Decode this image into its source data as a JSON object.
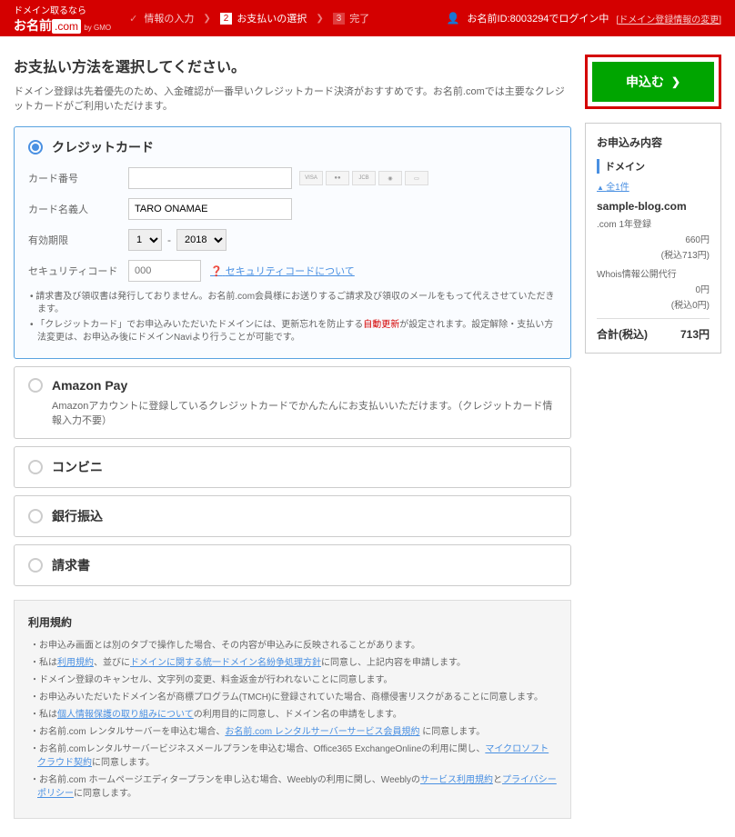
{
  "header": {
    "logo_tagline": "ドメイン取るなら",
    "logo_name": "お名前",
    "logo_suffix": ".com",
    "logo_sub": "by GMO",
    "steps": [
      {
        "num": "",
        "label": "情報の入力",
        "check": true
      },
      {
        "num": "2",
        "label": "お支払いの選択"
      },
      {
        "num": "3",
        "label": "完了"
      }
    ],
    "user_prefix": "お名前ID:8003294でログイン中",
    "settings_link": "[ドメイン登録情報の変更]"
  },
  "main": {
    "title": "お支払い方法を選択してください。",
    "desc": "ドメイン登録は先着優先のため、入金確認が一番早いクレジットカード決済がおすすめです。お名前.comでは主要なクレジットカードがご利用いただけます。",
    "credit": {
      "title": "クレジットカード",
      "card_no_label": "カード番号",
      "card_name_label": "カード名義人",
      "card_name_value": "TARO ONAMAE",
      "expiry_label": "有効期限",
      "expiry_month": "1",
      "expiry_year": "2018",
      "security_label": "セキュリティコード",
      "security_placeholder": "000",
      "security_help": "セキュリティコードについて",
      "note1": "請求書及び領収書は発行しておりません。お名前.com会員様にお送りするご請求及び領収のメールをもって代えさせていただきます。",
      "note2_pre": "「クレジットカード」でお申込みいただいたドメインには、更新忘れを防止する",
      "note2_red": "自動更新",
      "note2_post": "が設定されます。設定解除・支払い方法変更は、お申込み後にドメインNaviより行うことが可能です。"
    },
    "amazon": {
      "title": "Amazon Pay",
      "desc": "Amazonアカウントに登録しているクレジットカードでかんたんにお支払いいただけます。（クレジットカード情報入力不要）"
    },
    "convenience": {
      "title": "コンビニ"
    },
    "bank": {
      "title": "銀行振込"
    },
    "invoice": {
      "title": "請求書"
    },
    "terms": {
      "title": "利用規約",
      "items": [
        {
          "text": "お申込み画面とは別のタブで操作した場合、その内容が申込みに反映されることがあります。"
        },
        {
          "pre": "私は",
          "link1": "利用規約",
          "mid1": "、並びに",
          "link2": "ドメインに関する統一ドメイン名紛争処理方針",
          "post1": "に同意し、上記内容を申請します。"
        },
        {
          "text": "ドメイン登録のキャンセル、文字列の変更、料金返金が行われないことに同意します。"
        },
        {
          "text": "お申込みいただいたドメイン名が商標プログラム(TMCH)に登録されていた場合、商標侵害リスクがあることに同意します。"
        },
        {
          "pre": "私は",
          "link1": "個人情報保護の取り組みについて",
          "post1": "の利用目的に同意し、ドメイン名の申請をします。"
        },
        {
          "pre": "お名前.com レンタルサーバーを申込む場合、",
          "link1": "お名前.com レンタルサーバーサービス会員規約",
          "post1": " に同意します。"
        },
        {
          "pre": "お名前.comレンタルサーバービジネスメールプランを申込む場合、Office365 ExchangeOnlineの利用に関し、",
          "link1": "マイクロソフトクラウド契約",
          "post1": "に同意します。"
        },
        {
          "pre": "お名前.com ホームページエディタープランを申し込む場合、Weeblyの利用に関し、Weeblyの",
          "link1": "サービス利用規約",
          "mid1": "と",
          "link2": "プライバシーポリシー",
          "post1": "に同意します。"
        }
      ]
    }
  },
  "sidebar": {
    "apply_label": "申込む",
    "order_title": "お申込み内容",
    "domain_section": "ドメイン",
    "count_label": "全1件",
    "domain_name": "sample-blog.com",
    "reg_label": ".com 1年登録",
    "reg_price": "660円",
    "reg_tax": "(税込713円)",
    "whois_label": "Whois情報公開代行",
    "whois_price": "0円",
    "whois_tax": "(税込0円)",
    "total_label": "合計(税込)",
    "total_price": "713円"
  }
}
